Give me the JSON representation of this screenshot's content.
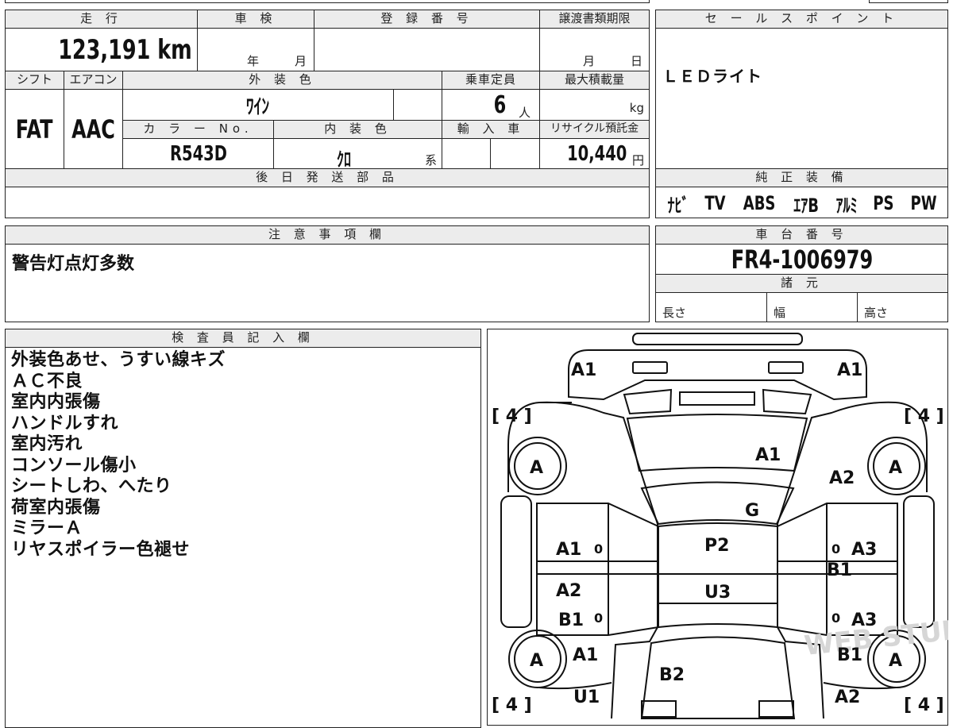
{
  "vehicle": {
    "mileage_header": "走 行",
    "mileage": "123,191 km",
    "inspection_header": "車 検",
    "inspection_year_label": "年",
    "inspection_month_label": "月",
    "registration_header": "登 録 番 号",
    "transfer_deadline_header": "譲渡書類期限",
    "transfer_month_label": "月",
    "transfer_day_label": "日",
    "shift_header": "シフト",
    "shift": "FAT",
    "aircon_header": "エアコン",
    "aircon": "AAC",
    "exterior_color_header": "外 装 色",
    "exterior_color": "ﾜｲﾝ",
    "capacity_header": "乗車定員",
    "capacity": "6",
    "capacity_unit": "人",
    "max_load_header": "最大積載量",
    "max_load_unit": "kg",
    "color_no_header": "カ ラ ー No.",
    "color_no": "R543D",
    "interior_color_header": "内 装 色",
    "interior_color": "ｸﾛ",
    "interior_suffix": "系",
    "import_header": "輸 入 車",
    "recycle_header": "リサイクル預託金",
    "recycle_fee": "10,440",
    "recycle_unit": "円",
    "later_parts_header": "後 日 発 送 部 品"
  },
  "sales_point": {
    "header": "セ ー ル ス ポ イ ン ト",
    "text": "ＬＥＤライト"
  },
  "equipment": {
    "header": "純 正 装 備",
    "items": [
      "ﾅﾋﾞ",
      "TV",
      "ABS",
      "ｴｱB",
      "ｱﾙﾐ",
      "PS",
      "PW"
    ]
  },
  "notes": {
    "header": "注 意 事 項 欄",
    "text": "警告灯点灯多数"
  },
  "chassis": {
    "header": "車 台 番 号",
    "number": "FR4-1006979",
    "specs_header": "諸 元",
    "length_label": "長さ",
    "width_label": "幅",
    "height_label": "高さ"
  },
  "inspector": {
    "header": "検 査 員 記 入 欄",
    "lines": [
      "外装色あせ、うすい線キズ",
      "ＡＣ不良",
      "室内内張傷",
      "ハンドルすれ",
      "室内汚れ",
      "コンソール傷小",
      "シートしわ、へたり",
      "荷室内張傷",
      "ミラーＡ",
      "リヤスポイラー色褪せ"
    ]
  },
  "diagram": {
    "tire_depth": [
      "[ 4 ]",
      "[ 4 ]",
      "[ 4 ]",
      "[ 4 ]"
    ],
    "wheel_grade": [
      "A",
      "A",
      "A",
      "A"
    ],
    "marks": {
      "front_left_corner": "A1",
      "front_right_corner": "A1",
      "hood": "A1",
      "front_right_fender": "A2",
      "windshield": "G",
      "roof_front": "P2",
      "roof_rear": "U3",
      "left_front_door": "A1",
      "left_front_door_b": "0",
      "left_rear_door": "A2",
      "left_rear_door_b": "B1",
      "left_rear_door_c": "0",
      "right_front_door_a": "0",
      "right_front_door_b": "A3",
      "right_front_door_c": "B1",
      "right_rear_door_a": "0",
      "right_rear_door_b": "A3",
      "left_rear_fender": "A1",
      "right_rear_fender": "B1",
      "rear_gate": "B2",
      "left_rear_bumper": "U1",
      "right_rear_bumper": "A2"
    },
    "watermark": "WEB STUDIO"
  }
}
